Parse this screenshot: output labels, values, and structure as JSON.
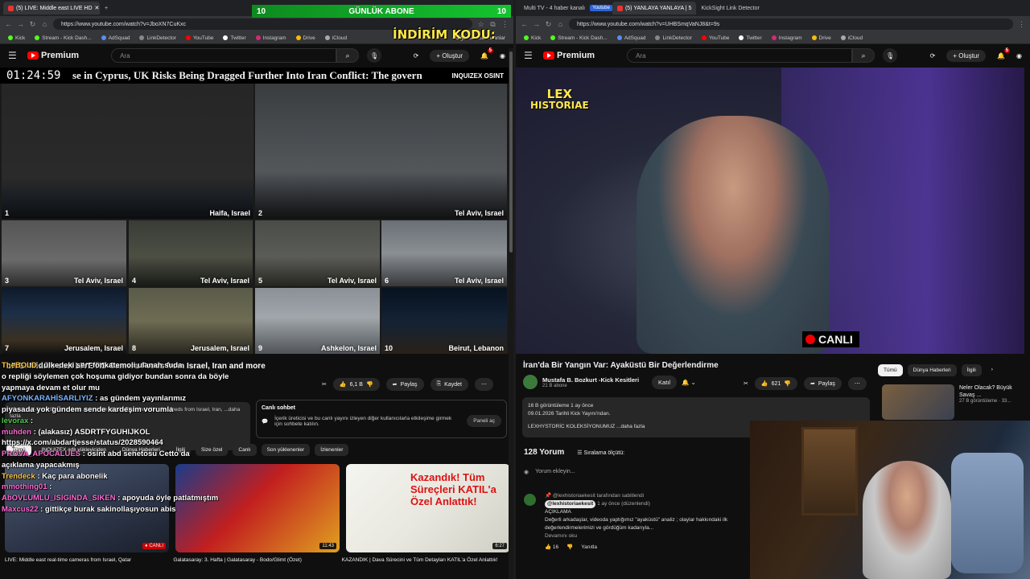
{
  "left": {
    "tabs": [
      {
        "label": "(5) LIVE: Middle east LIVE HD",
        "active": true
      }
    ],
    "url": "https://www.youtube.com/watch?v=JboXN7CuKxc",
    "bookmarks": [
      "Kick",
      "Stream - Kick Dash...",
      "AdSquad",
      "LinkDetector",
      "YouTube",
      "Twitter",
      "Instagram",
      "Drive",
      "iCloud",
      "Diğer sık kullanılanlar"
    ],
    "header": {
      "brand": "Premium",
      "search_placeholder": "Ara",
      "create_label": "Oluştur",
      "notif_count": "5"
    },
    "video": {
      "clock": "01:24:59",
      "ticker": "se in Cyprus, UK Risks Being Dragged Further Into Iran Conflict: The govern",
      "watermark": "INQUIZEX OSINT",
      "cams": [
        {
          "num": "1",
          "label": "Haifa, Israel"
        },
        {
          "num": "2",
          "label": "Tel Aviv, Israel"
        },
        {
          "num": "3",
          "label": "Tel Aviv, Israel"
        },
        {
          "num": "4",
          "label": "Tel Aviv, Israel"
        },
        {
          "num": "5",
          "label": "Tel Aviv, Israel"
        },
        {
          "num": "6",
          "label": "Tel Aviv, Israel"
        },
        {
          "num": "7",
          "label": "Jerusalem, Israel"
        },
        {
          "num": "8",
          "label": "Jerusalem, Israel"
        },
        {
          "num": "9",
          "label": "Ashkelon, Israel"
        },
        {
          "num": "10",
          "label": "Beirut, Lebanon"
        }
      ]
    },
    "title": "LIVE: Middle east LIVE HD Camera Feeds from Israel, Iran and more",
    "actions": {
      "likes": "6,1 B",
      "share": "Paylaş",
      "save": "Kaydet"
    },
    "description": "Watch real-time HD views from across the Middle East, including live feeds from Israel, Iran, ...daha fazla",
    "live_chat": {
      "title": "Canlı sohbet",
      "text": "İçerik üreticisi ve bu canlı yayını izleyen diğer kullanıcılarla etkileşime girmek için sohbete katılın.",
      "button": "Paneli aç"
    },
    "chips": [
      "Tümü",
      "INQUIZEX adlı yükleyiciden",
      "Dünya Haberleri",
      "İlgili",
      "Size özel",
      "Canlı",
      "Son yüklenenler",
      "İzlenenler"
    ],
    "thumbs": [
      {
        "duration": "",
        "title": "LIVE: Middle east real-time cameras from Israel, Qatar"
      },
      {
        "duration": "11:43",
        "title": "Galatasaray: 3. Hafta | Galatasaray - Bodo/Glimt (Özet)"
      },
      {
        "duration": "6:27",
        "title": "KAZANDIK | Dava Sürecini ve Tüm Detayları KATIL'a Özel Anlattık!"
      }
    ],
    "thumb_overlay": "Kazandık! Tüm Süreçleri KATIL'a Özel Anlattık!",
    "overlay_chat": [
      {
        "user": "TheBOLD",
        "text": "ülkedeki sert fönkatemoli ulanan suda",
        "cls": "u2"
      },
      {
        "user": "",
        "text": "o repliği söylemen çok hoşuma gidiyor bundan sonra da böyle",
        "cls": ""
      },
      {
        "user": "",
        "text": "yapmaya devam et olur mu",
        "cls": ""
      },
      {
        "user": "AFYONKARAHİSARLIYIZ",
        "text": "as gündem yayınlarımız",
        "cls": "u4"
      },
      {
        "user": "",
        "text": "piyasada yok gündem sende kardeşim vorumla",
        "cls": ""
      },
      {
        "user": "levorax",
        "text": "",
        "cls": "u"
      },
      {
        "user": "muhden",
        "text": "(alakasız) ASDRTFYGUHIJKOL",
        "cls": "u3"
      },
      {
        "user": "",
        "text": "https://x.com/abdartjesse/status/2028590464",
        "cls": ""
      },
      {
        "user": "PROVA_APOCALUES",
        "text": "osint abd senetosu Cetto da",
        "cls": "u3"
      },
      {
        "user": "",
        "text": "açıklama yapacakmış",
        "cls": ""
      },
      {
        "user": "Trendeck",
        "text": "Kaç para abonelik",
        "cls": "u2"
      },
      {
        "user": "mmothing01",
        "text": "",
        "cls": "u3"
      },
      {
        "user": "AbOVLUMLU_ISIGINDA_SIKEN",
        "text": "apoyuda öyle patlatmıştım",
        "cls": "u3"
      },
      {
        "user": "Maxcus22",
        "text": "gittikçe burak sakinollaşıyosun abis",
        "cls": "u3"
      }
    ]
  },
  "right": {
    "tabs": [
      {
        "label": "Multi TV - 4 haber kanalı",
        "active": false
      },
      {
        "label": "(5) YANLAYA YANLAYA | 5",
        "active": true
      },
      {
        "label": "KickSight Link Detector",
        "active": false
      }
    ],
    "tab_badge": "Youtube",
    "url": "https://www.youtube.com/watch?v=UHBSmqVaNJ8&t=9s",
    "bookmarks": [
      "Kick",
      "Stream - Kick Dash...",
      "AdSquad",
      "LinkDetector",
      "YouTube",
      "Twitter",
      "Instagram",
      "Drive",
      "iCloud"
    ],
    "header": {
      "brand": "Premium",
      "search_placeholder": "Ara",
      "create_label": "Oluştur",
      "notif_count": "5"
    },
    "video": {
      "logo_line1": "LEX",
      "logo_line2": "HISTORIAE",
      "live_label": "CANLI"
    },
    "title": "İran'da Bir Yangın Var: Ayaküstü Bir Değerlendirme",
    "channel": {
      "name": "Mustafa B. Bozkurt -Kick Kesitleri",
      "subs": "21 B abone",
      "join": "Katıl"
    },
    "actions": {
      "likes": "621",
      "share": "Paylaş"
    },
    "description": {
      "line1": "16 B görüntüleme  1 ay önce",
      "line2": "09.01.2026 Tarihli Kick Yayını'ndan.",
      "line3": "LEXHYSTORİC KOLEKSİYONUMUZ   ...daha fazla"
    },
    "comments": {
      "count": "128 Yorum",
      "sort": "Sıralama ölçütü:",
      "add": "Yorum ekleyin...",
      "pinned_by": "@lexhistoriaekesit tarafından sabitlendi",
      "author": "@lexhistoriaekesit",
      "time": "1 ay önce (düzenlendi)",
      "heading": "AÇIKLAMA",
      "text": "Değerli arkadaşlar, videoda yaptığımız \"ayaküstü\" analiz ; olaylar hakkındaki ilk değerlendirmelerimizi ve gördüğüm kadarıyla...",
      "more": "Devamını oku",
      "likes": "16",
      "reply": "Yanıtla"
    },
    "side_chips": [
      "Tümü",
      "Dünya Haberleri",
      "İlgili"
    ],
    "side_video": {
      "title": "Neler Olacak? Büyük Savaş ...",
      "meta": "27 B görüntüleme · 33..."
    },
    "overlay_sub": {
      "left": "10",
      "label": "GÜNLÜK ABONE",
      "right": "10"
    },
    "overlay_promo": "İNDİRİM KODU:"
  },
  "colors": {
    "accent": "#ff0000",
    "bg": "#0f0f0f",
    "chip": "#272727",
    "overlay_yellow": "#ffe94a",
    "sub_green": "#14c42f"
  }
}
